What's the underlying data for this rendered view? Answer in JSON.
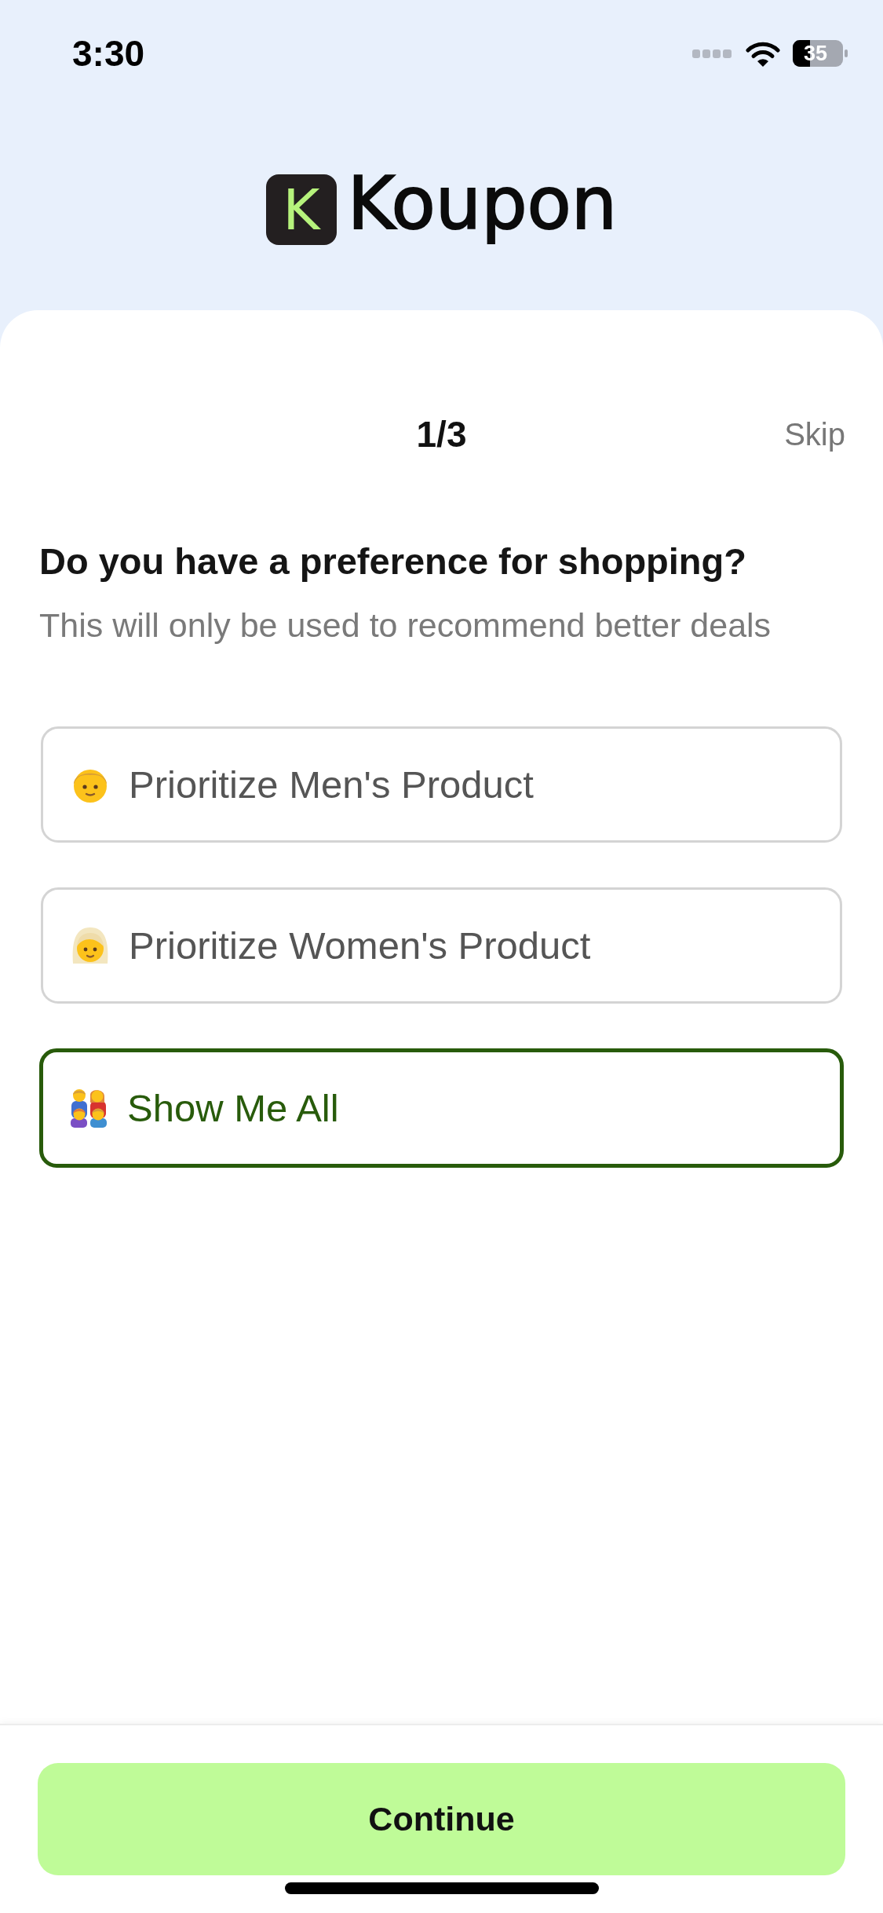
{
  "status_bar": {
    "time": "3:30",
    "battery": "35"
  },
  "brand": {
    "mark": "K",
    "name": "Koupon"
  },
  "header": {
    "step": "1/3",
    "skip": "Skip"
  },
  "question": {
    "title": "Do you have a preference for shopping?",
    "subtitle": "This will only be used to recommend better deals"
  },
  "options": [
    {
      "kind": "men",
      "label": "Prioritize Men's Product",
      "selected": false
    },
    {
      "kind": "women",
      "label": "Prioritize Women's Product",
      "selected": false
    },
    {
      "kind": "all",
      "label": "Show Me All",
      "selected": true
    }
  ],
  "continue_button": {
    "label": "Continue"
  }
}
